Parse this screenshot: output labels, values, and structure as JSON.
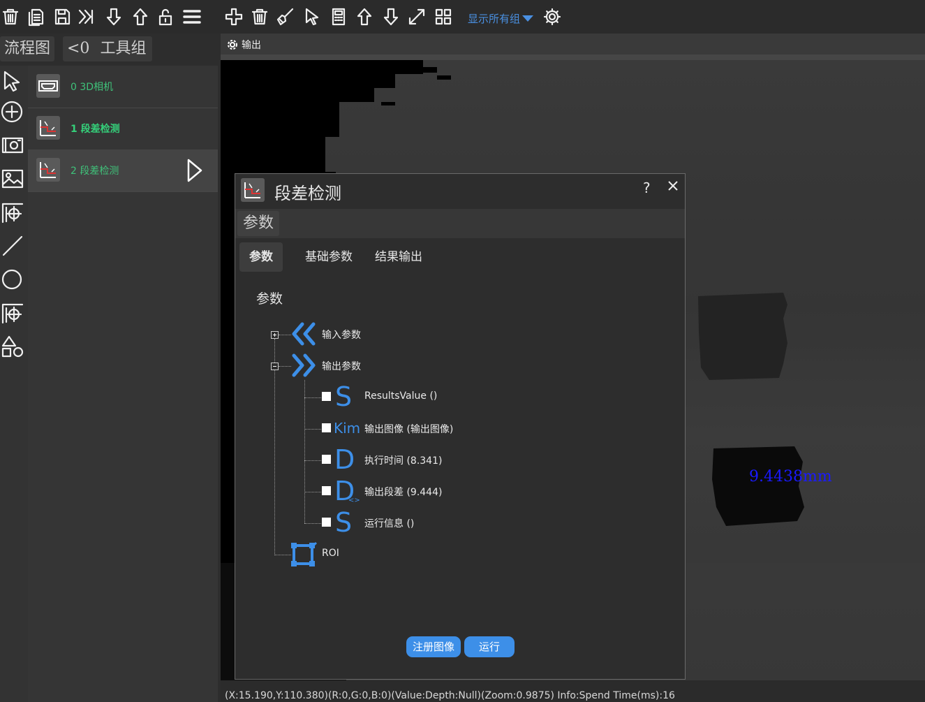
{
  "toolbar": {
    "show_all_groups": "显示所有组"
  },
  "left_tabs": {
    "flowchart": "流程图",
    "group_prefix": "<0",
    "tool_group": "工具组"
  },
  "flow_items": [
    {
      "label": "0  3D相机"
    },
    {
      "label": "1  段差检测"
    },
    {
      "label": "2  段差检测"
    }
  ],
  "output": {
    "title": "输出",
    "measurement": "9.4438mm"
  },
  "dialog": {
    "title": "段差检测",
    "help": "?",
    "params_tab": "参数",
    "tabs": [
      "参数",
      "基础参数",
      "结果输出"
    ],
    "section": "参数",
    "tree": {
      "input_params": "输入参数",
      "output_params": "输出参数",
      "outputs": [
        {
          "letter": "S",
          "label": "ResultsValue  ()"
        },
        {
          "letter": "Kim",
          "label": "输出图像  (输出图像)"
        },
        {
          "letter": "D",
          "label": "执行时间  (8.341)"
        },
        {
          "letter": "D",
          "label": "输出段差  (9.444)"
        },
        {
          "letter": "S",
          "label": "运行信息  ()"
        }
      ],
      "roi": "ROI"
    },
    "register_image": "注册图像",
    "run": "运行"
  },
  "status": {
    "text": "(X:15.190,Y:110.380)(R:0,G:0,B:0)(Value:Depth:Null)(Zoom:0.9875)   Info:Spend Time(ms):16"
  }
}
